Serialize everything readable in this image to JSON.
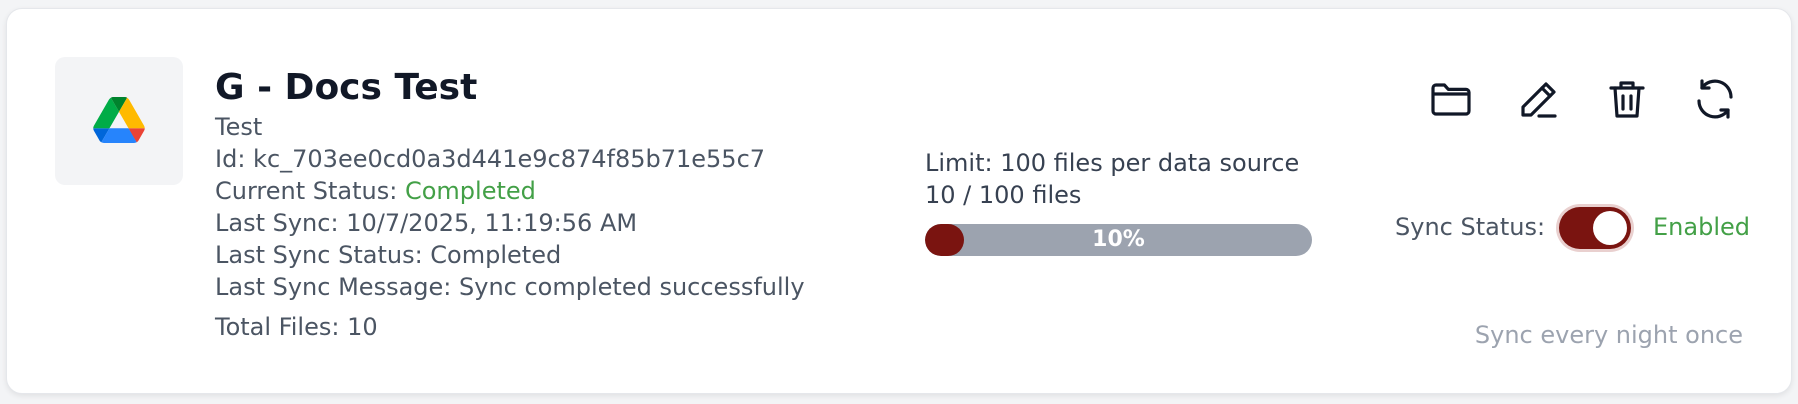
{
  "source": {
    "title": "G - Docs Test",
    "description": "Test",
    "id_label": "Id:",
    "id_value": "kc_703ee0cd0a3d441e9c874f85b71e55c7",
    "current_status_label": "Current Status:",
    "current_status_value": "Completed",
    "last_sync_label": "Last Sync:",
    "last_sync_value": "10/7/2025, 11:19:56 AM",
    "last_sync_status_label": "Last Sync Status:",
    "last_sync_status_value": "Completed",
    "last_sync_message_label": "Last Sync Message:",
    "last_sync_message_value": "Sync completed successfully",
    "total_files_label": "Total Files:",
    "total_files_value": "10"
  },
  "usage": {
    "limit_text": "Limit: 100 files per data source",
    "count_text": "10 / 100 files",
    "progress_fraction": 0.1,
    "progress_label": "10%"
  },
  "actions": {
    "icons": [
      "folder-icon",
      "edit-icon",
      "trash-icon",
      "refresh-icon"
    ]
  },
  "sync": {
    "label": "Sync Status:",
    "enabled": true,
    "state_text": "Enabled",
    "schedule": "Sync every night once"
  },
  "colors": {
    "accent": "#7a1410",
    "success": "#43a047",
    "track": "#9ca3af"
  }
}
